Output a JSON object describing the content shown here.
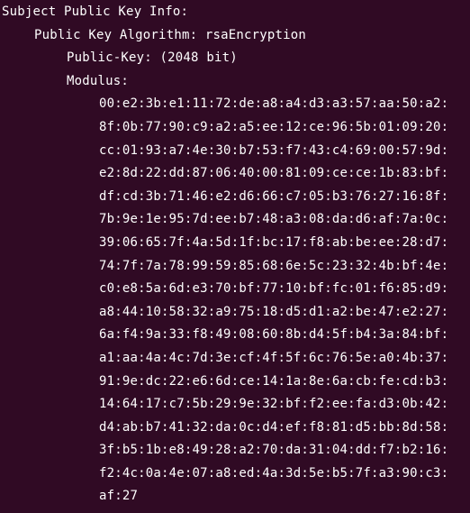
{
  "terminal": {
    "background": "#300a24",
    "foreground": "#ffffff",
    "subject_public_key_info": "Subject Public Key Info:",
    "public_key_algorithm": "Public Key Algorithm: rsaEncryption",
    "public_key": "Public-Key: (2048 bit)",
    "modulus_label": "Modulus:",
    "modulus_lines": [
      "00:e2:3b:e1:11:72:de:a8:a4:d3:a3:57:aa:50:a2:",
      "8f:0b:77:90:c9:a2:a5:ee:12:ce:96:5b:01:09:20:",
      "cc:01:93:a7:4e:30:b7:53:f7:43:c4:69:00:57:9d:",
      "e2:8d:22:dd:87:06:40:00:81:09:ce:ce:1b:83:bf:",
      "df:cd:3b:71:46:e2:d6:66:c7:05:b3:76:27:16:8f:",
      "7b:9e:1e:95:7d:ee:b7:48:a3:08:da:d6:af:7a:0c:",
      "39:06:65:7f:4a:5d:1f:bc:17:f8:ab:be:ee:28:d7:",
      "74:7f:7a:78:99:59:85:68:6e:5c:23:32:4b:bf:4e:",
      "c0:e8:5a:6d:e3:70:bf:77:10:bf:fc:01:f6:85:d9:",
      "a8:44:10:58:32:a9:75:18:d5:d1:a2:be:47:e2:27:",
      "6a:f4:9a:33:f8:49:08:60:8b:d4:5f:b4:3a:84:bf:",
      "a1:aa:4a:4c:7d:3e:cf:4f:5f:6c:76:5e:a0:4b:37:",
      "91:9e:dc:22:e6:6d:ce:14:1a:8e:6a:cb:fe:cd:b3:",
      "14:64:17:c7:5b:29:9e:32:bf:f2:ee:fa:d3:0b:42:",
      "d4:ab:b7:41:32:da:0c:d4:ef:f8:81:d5:bb:8d:58:",
      "3f:b5:1b:e8:49:28:a2:70:da:31:04:dd:f7:b2:16:",
      "f2:4c:0a:4e:07:a8:ed:4a:3d:5e:b5:7f:a3:90:c3:",
      "af:27"
    ]
  }
}
